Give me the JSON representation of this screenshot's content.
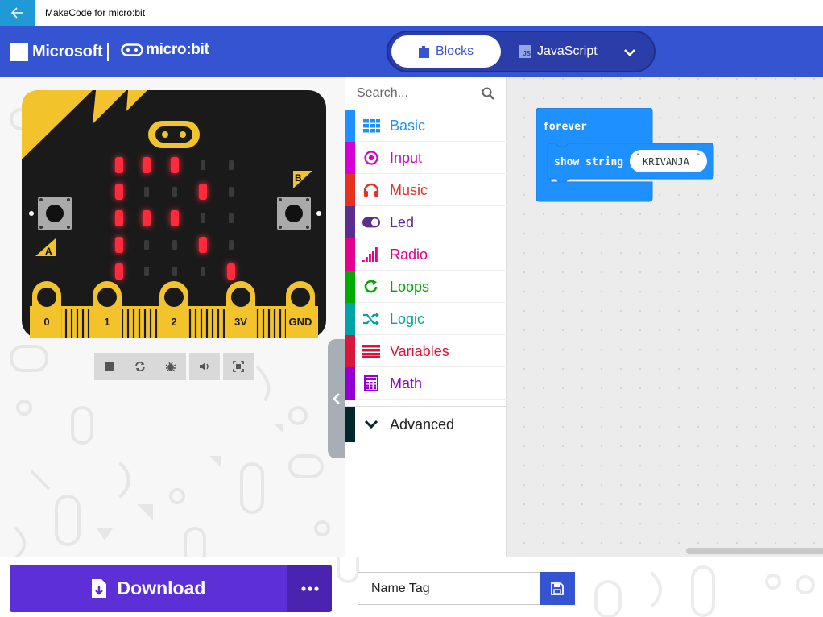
{
  "window": {
    "title": "MakeCode for micro:bit"
  },
  "header": {
    "brand": "Microsoft",
    "product": "micro:bit",
    "tabs": {
      "blocks": "Blocks",
      "javascript": "JavaScript",
      "js_badge": "JS"
    }
  },
  "simulator": {
    "pins": [
      "0",
      "1",
      "2",
      "3V",
      "GND"
    ],
    "button_a": "A",
    "button_b": "B",
    "led_matrix": [
      [
        1,
        1,
        1,
        0,
        0
      ],
      [
        1,
        0,
        0,
        1,
        0
      ],
      [
        1,
        1,
        1,
        0,
        0
      ],
      [
        1,
        0,
        0,
        1,
        0
      ],
      [
        1,
        0,
        0,
        0,
        1
      ]
    ],
    "led_color": "#ff2b3c"
  },
  "toolbox": {
    "search_placeholder": "Search...",
    "categories": [
      {
        "label": "Basic",
        "color": "#1e90ff",
        "icon": "grid-icon"
      },
      {
        "label": "Input",
        "color": "#d400d4",
        "icon": "target-icon"
      },
      {
        "label": "Music",
        "color": "#e63022",
        "icon": "headphones-icon"
      },
      {
        "label": "Led",
        "color": "#5c2d91",
        "icon": "toggle-icon"
      },
      {
        "label": "Radio",
        "color": "#e3008c",
        "icon": "signal-icon"
      },
      {
        "label": "Loops",
        "color": "#00aa00",
        "icon": "refresh-icon"
      },
      {
        "label": "Logic",
        "color": "#00a4a6",
        "icon": "shuffle-icon"
      },
      {
        "label": "Variables",
        "color": "#dc143c",
        "icon": "lines-icon"
      },
      {
        "label": "Math",
        "color": "#9400d3",
        "icon": "calculator-icon"
      }
    ],
    "advanced": {
      "label": "Advanced",
      "color": "#00272b"
    }
  },
  "workspace": {
    "forever_label": "forever",
    "show_string_label": "show string",
    "string_value": "KRIVANJA",
    "block_color": "#1e90ff"
  },
  "bottom": {
    "download_label": "Download",
    "project_name": "Name Tag"
  }
}
